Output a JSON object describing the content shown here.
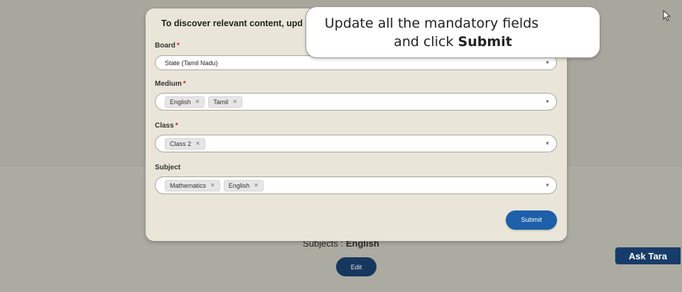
{
  "background": {
    "subjects_label": "Subjects :",
    "subjects_value": "English",
    "edit_label": "Edit",
    "ask_tara_label": "Ask Tara"
  },
  "modal": {
    "heading": "To discover relevant content, upd",
    "fields": {
      "board": {
        "label": "Board",
        "required_mark": "*",
        "value": "State (Tamil Nadu)"
      },
      "medium": {
        "label": "Medium",
        "required_mark": "*",
        "chips": [
          "English",
          "Tamil"
        ]
      },
      "class": {
        "label": "Class",
        "required_mark": "*",
        "chips": [
          "Class 2"
        ]
      },
      "subject": {
        "label": "Subject",
        "chips": [
          "Mathematics",
          "English"
        ]
      }
    },
    "submit_label": "Submit"
  },
  "tooltip": {
    "line1": "Update all the mandatory fields",
    "line2_prefix": "and click ",
    "line2_bold": "Submit"
  }
}
